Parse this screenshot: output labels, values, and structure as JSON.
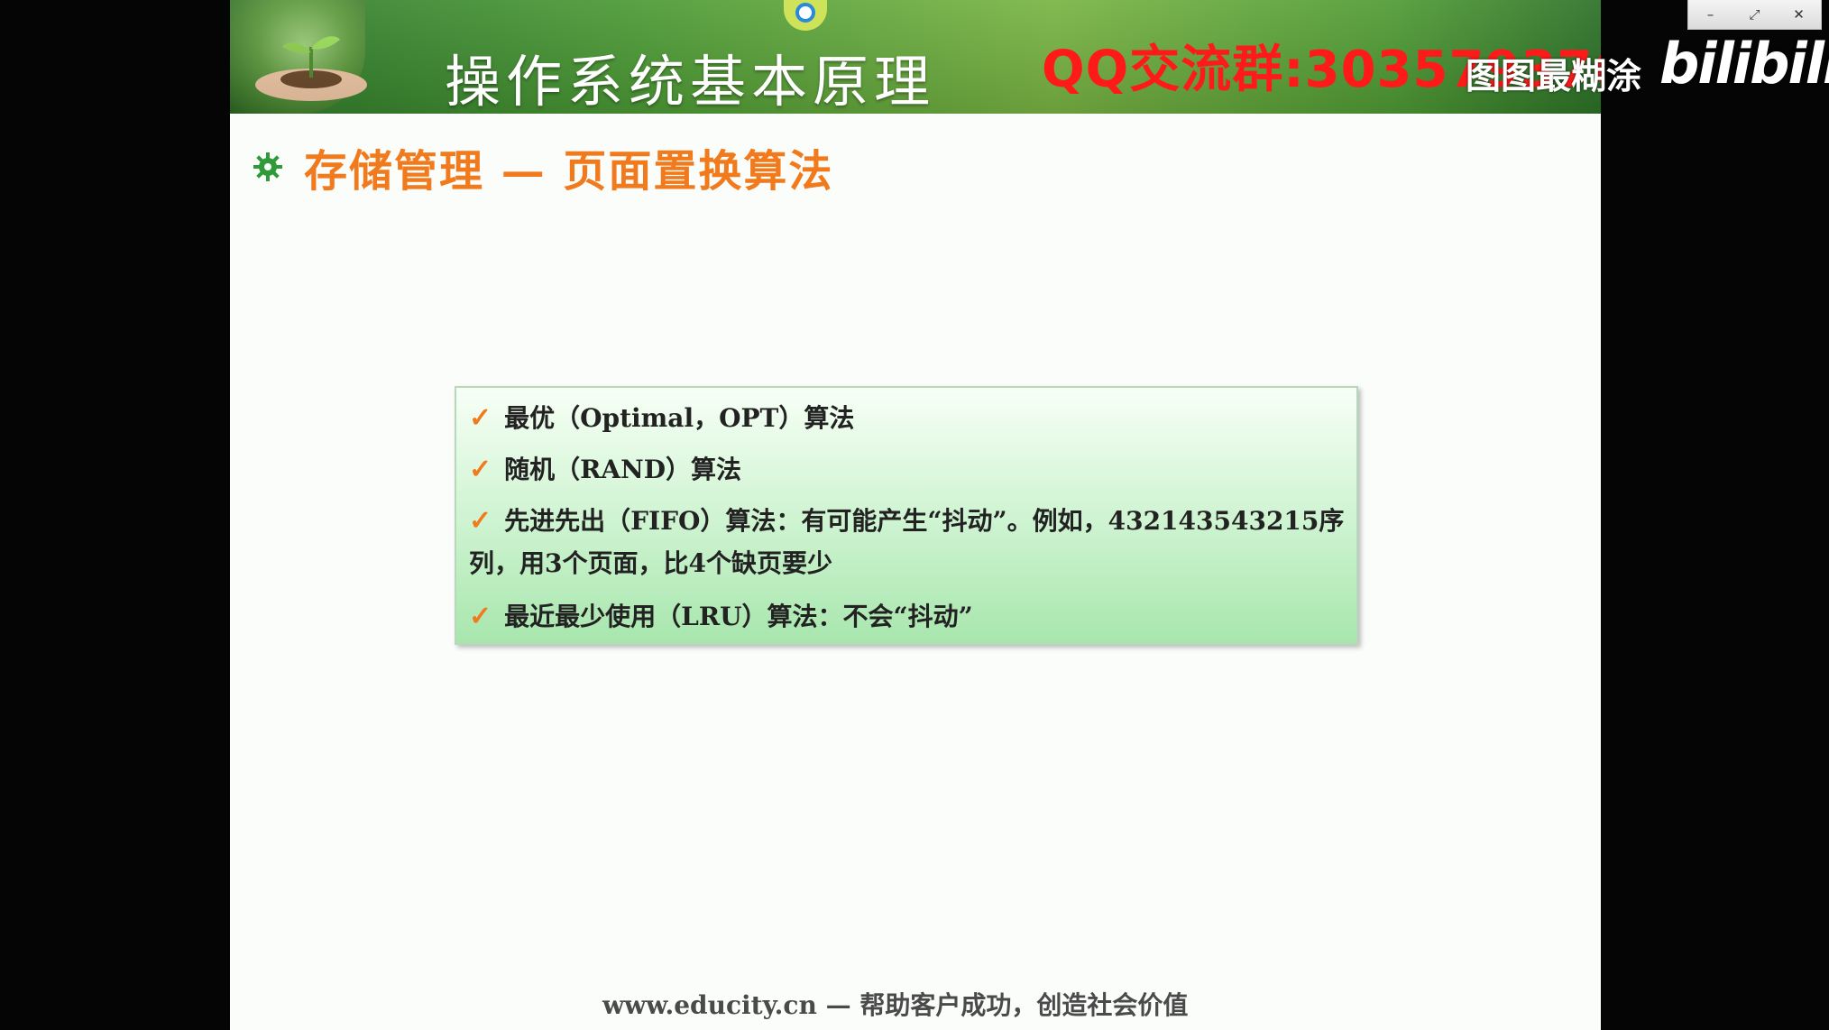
{
  "window": {
    "minimize_icon": "–",
    "restore_icon": "⤢",
    "close_icon": "✕"
  },
  "slide": {
    "banner_title": "操作系统基本原理",
    "qq_group": "QQ交流群:303579376",
    "subtitle": "存储管理 — 页面置换算法",
    "items": [
      "最优（Optimal，OPT）算法",
      "随机（RAND）算法",
      "先进先出（FIFO）算法：有可能产生“抖动”。例如，432143543215序列，用3个页面，比4个缺页要少",
      "最近最少使用（LRU）算法：不会“抖动”"
    ],
    "check_mark": "✓",
    "footer": "www.educity.cn — 帮助客户成功，创造社会价值"
  },
  "watermark": {
    "uploader": "图图最糊涂",
    "logo": "bilibili"
  },
  "colors": {
    "accent_orange": "#f07a1c",
    "banner_green": "#4c9a35",
    "qq_red": "#ff1a1a"
  }
}
